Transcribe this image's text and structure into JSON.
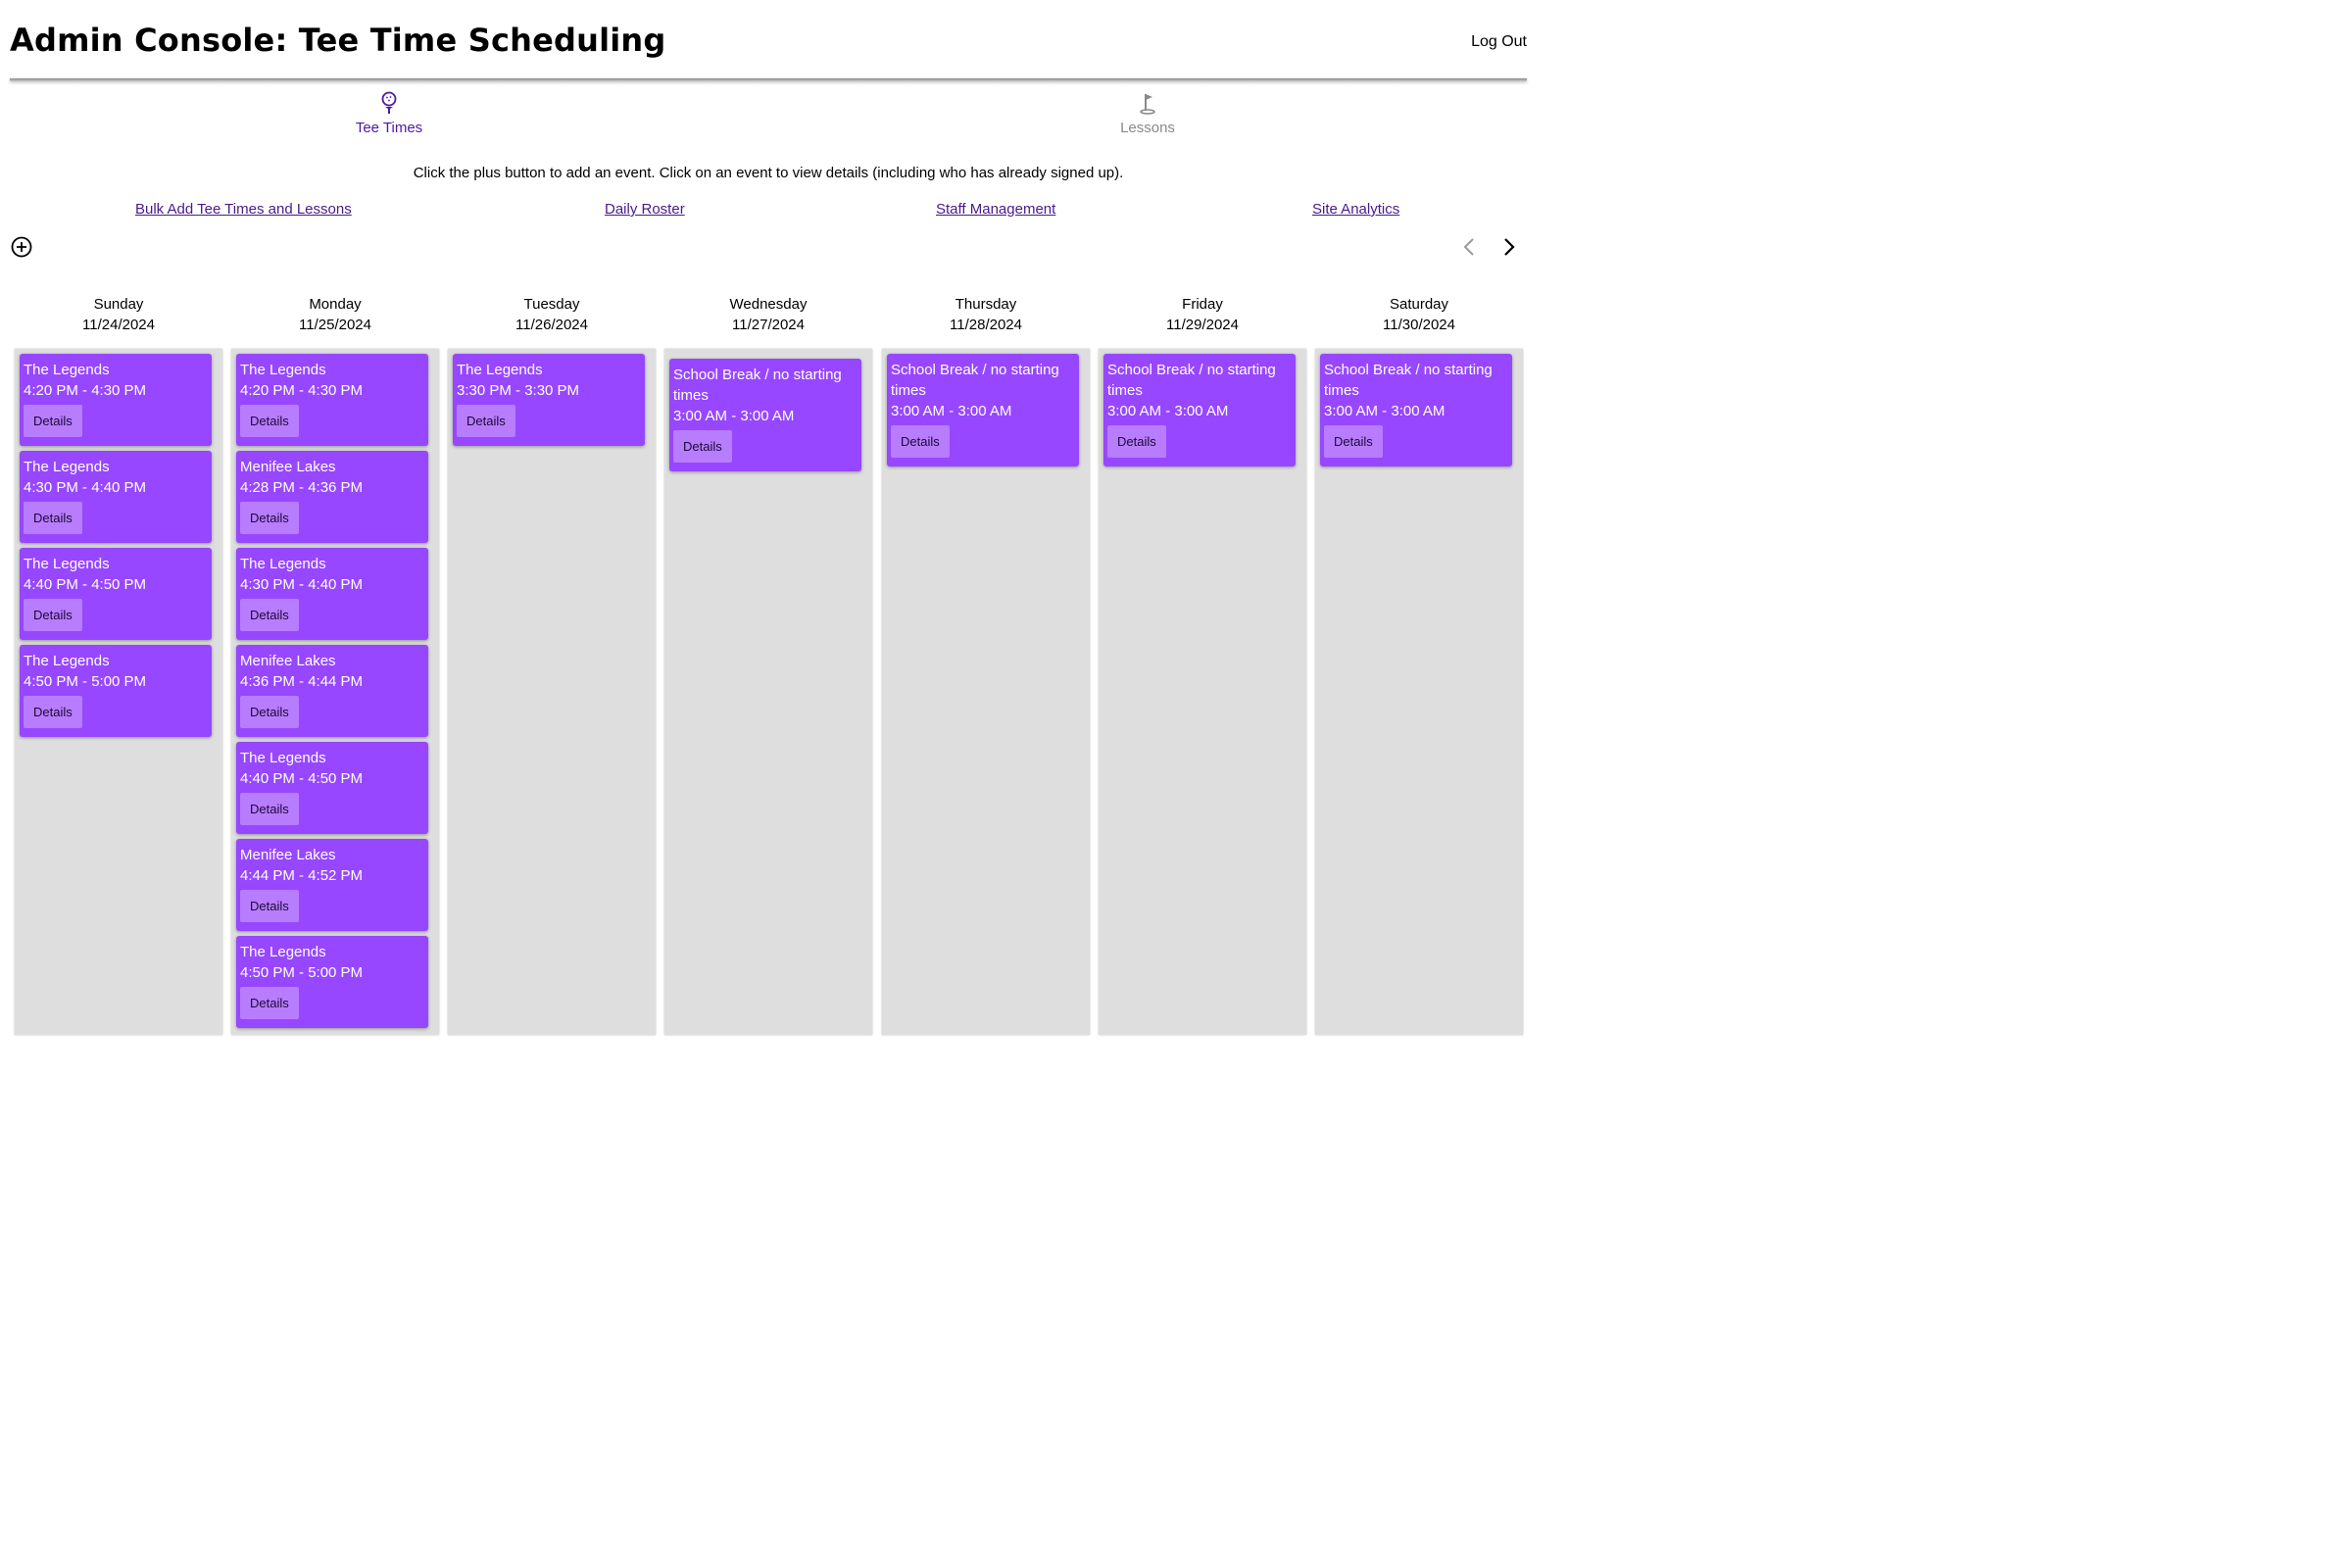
{
  "header": {
    "title": "Admin Console: Tee Time Scheduling",
    "logout_label": "Log Out"
  },
  "tabs": [
    {
      "label": "Tee Times",
      "icon": "golf-ball-on-tee-icon",
      "active": true
    },
    {
      "label": "Lessons",
      "icon": "golf-flag-icon",
      "active": false
    }
  ],
  "instructions": "Click the plus button to add an event. Click on an event to view details (including who has already signed up).",
  "links": [
    "Bulk Add Tee Times and Lessons",
    "Daily Roster",
    "Staff Management",
    "Site Analytics"
  ],
  "controls": {
    "add_icon": "plus-circle-icon",
    "prev_icon": "chevron-left-icon",
    "next_icon": "chevron-right-icon"
  },
  "colors": {
    "event_bg": "#9747ff",
    "details_bg": "#b87cff",
    "column_bg": "#dedede",
    "active_tab": "#4a1aa8",
    "link": "#4a1a8a"
  },
  "details_label": "Details",
  "days": [
    {
      "name": "Sunday",
      "date": "11/24/2024",
      "events": [
        {
          "title": "The Legends",
          "time": "4:20 PM - 4:30 PM"
        },
        {
          "title": "The Legends",
          "time": "4:30 PM - 4:40 PM"
        },
        {
          "title": "The Legends",
          "time": "4:40 PM - 4:50 PM"
        },
        {
          "title": "The Legends",
          "time": "4:50 PM - 5:00 PM"
        }
      ]
    },
    {
      "name": "Monday",
      "date": "11/25/2024",
      "events": [
        {
          "title": "The Legends",
          "time": "4:20 PM - 4:30 PM"
        },
        {
          "title": "Menifee Lakes",
          "time": "4:28 PM - 4:36 PM"
        },
        {
          "title": "The Legends",
          "time": "4:30 PM - 4:40 PM"
        },
        {
          "title": "Menifee Lakes",
          "time": "4:36 PM - 4:44 PM"
        },
        {
          "title": "The Legends",
          "time": "4:40 PM - 4:50 PM"
        },
        {
          "title": "Menifee Lakes",
          "time": "4:44 PM - 4:52 PM"
        },
        {
          "title": "The Legends",
          "time": "4:50 PM - 5:00 PM"
        }
      ]
    },
    {
      "name": "Tuesday",
      "date": "11/26/2024",
      "events": [
        {
          "title": "The Legends",
          "time": "3:30 PM - 3:30 PM"
        }
      ]
    },
    {
      "name": "Wednesday",
      "date": "11/27/2024",
      "events": [
        {
          "title": "School Break / no starting times",
          "time": "3:00 AM - 3:00 AM"
        }
      ]
    },
    {
      "name": "Thursday",
      "date": "11/28/2024",
      "events": [
        {
          "title": "School Break / no starting times",
          "time": "3:00 AM - 3:00 AM"
        }
      ]
    },
    {
      "name": "Friday",
      "date": "11/29/2024",
      "events": [
        {
          "title": "School Break / no starting times",
          "time": "3:00 AM - 3:00 AM"
        }
      ]
    },
    {
      "name": "Saturday",
      "date": "11/30/2024",
      "events": [
        {
          "title": "School Break / no starting times",
          "time": "3:00 AM - 3:00 AM"
        }
      ]
    }
  ]
}
